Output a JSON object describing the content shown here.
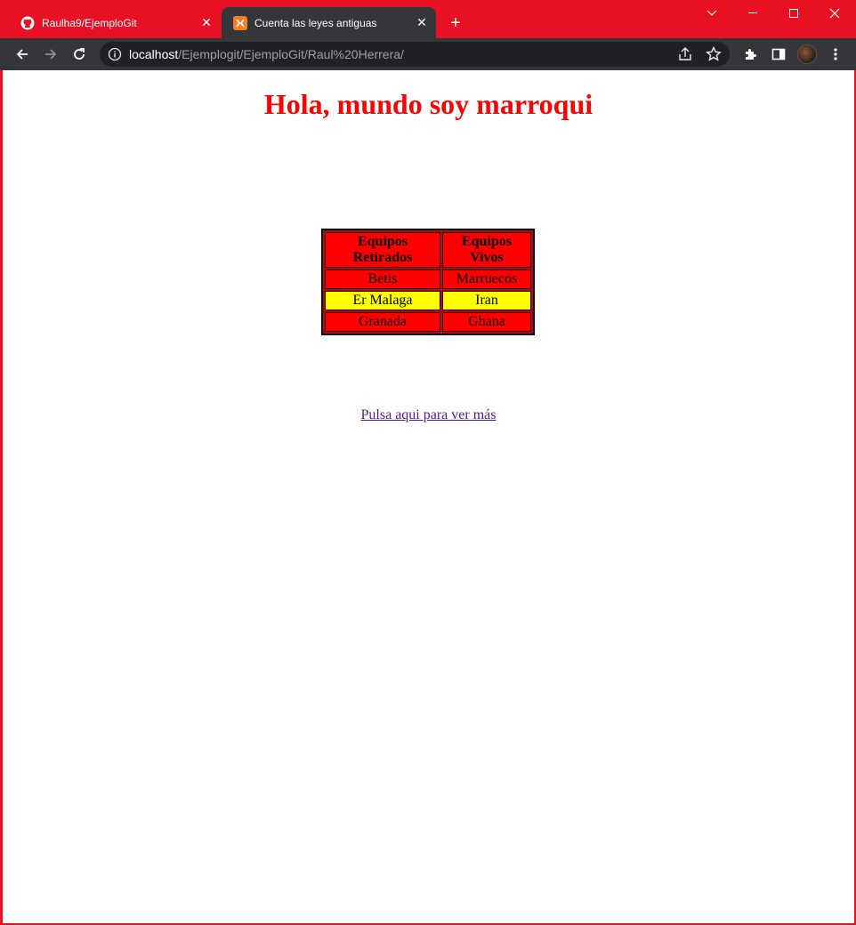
{
  "tabs": [
    {
      "title": "Raulha9/EjemploGit",
      "icon": "github-icon",
      "active": false
    },
    {
      "title": "Cuenta las leyes antiguas",
      "icon": "xampp-icon",
      "active": true
    }
  ],
  "address_bar": {
    "host": "localhost",
    "path": "/Ejemplogit/EjemploGit/Raul%20Herrera/"
  },
  "page": {
    "heading": "Hola, mundo soy marroqui",
    "table": {
      "headers": [
        "Equipos Retirados",
        "Equipos Vivos"
      ],
      "rows": [
        [
          "Betis",
          "Marruecos"
        ],
        [
          "Er Malaga",
          "Iran"
        ],
        [
          "Granada",
          "Ghana"
        ]
      ],
      "row_colors": [
        "#ff0000",
        "#ffff00",
        "#ff0000"
      ]
    },
    "link_text": "Pulsa aqui para ver más"
  },
  "colors": {
    "window_frame": "#e81123",
    "heading": "#ff0000",
    "link_visited": "#551a8b"
  }
}
